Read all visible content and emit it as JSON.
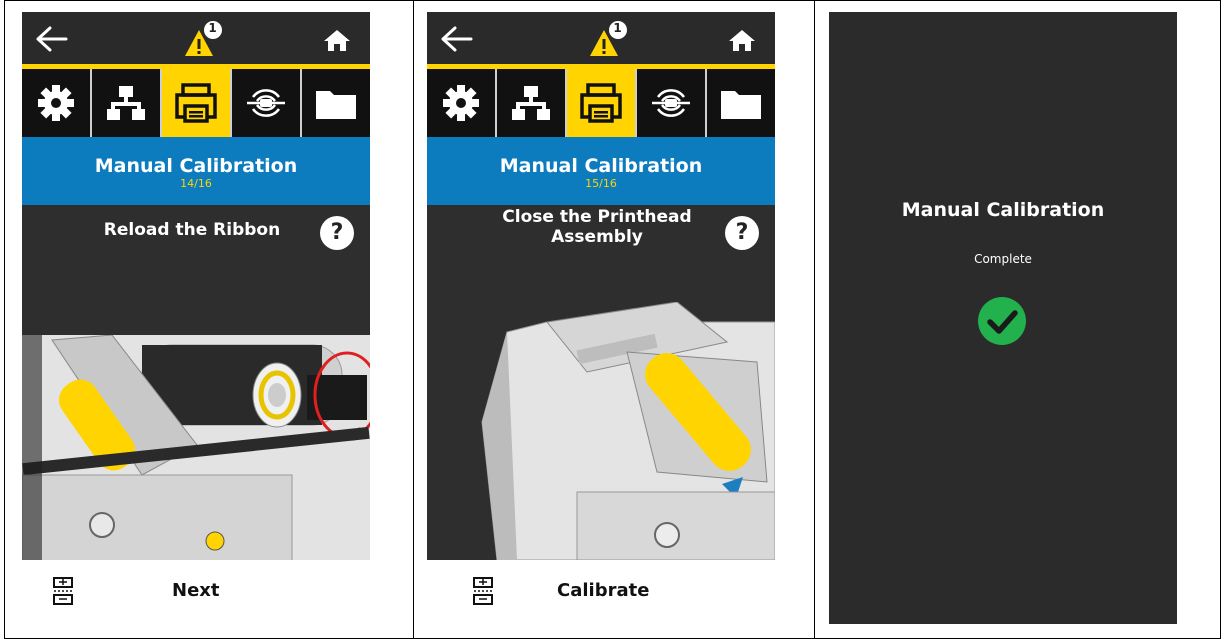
{
  "panel1": {
    "title": "Manual Calibration",
    "step": "14/16",
    "instruction": "Reload the Ribbon",
    "help": "?",
    "button": "Next",
    "alert_count": "1"
  },
  "panel2": {
    "title": "Manual Calibration",
    "step": "15/16",
    "instruction_line1": "Close the Printhead",
    "instruction_line2": "Assembly",
    "help": "?",
    "button": "Calibrate",
    "alert_count": "1"
  },
  "panel3": {
    "title": "Manual Calibration",
    "status": "Complete"
  },
  "icons": {
    "back": "arrow-left",
    "alert": "warning-triangle",
    "home": "house",
    "tabs": [
      "gear",
      "network",
      "printer",
      "wireless",
      "folder"
    ],
    "status": "checkmark-circle",
    "calibrate": "calibrate"
  },
  "colors": {
    "accent_yellow": "#ffd400",
    "band_blue": "#0c7cbf",
    "screen_dark": "#2e2e2e",
    "success_green": "#22b14c",
    "alert_red": "#e02020"
  }
}
